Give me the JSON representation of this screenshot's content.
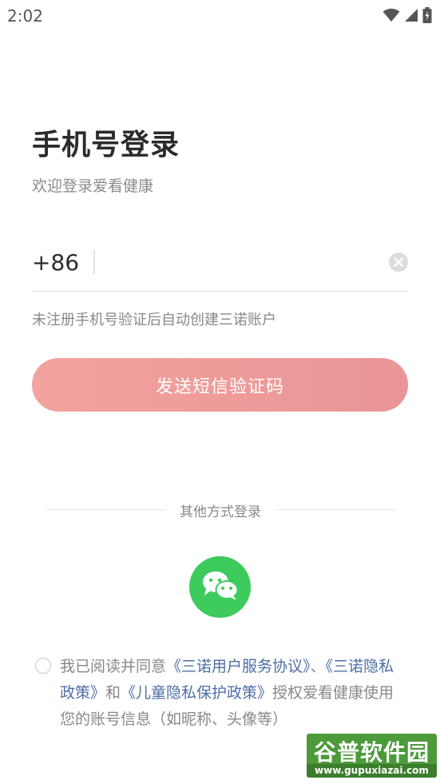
{
  "status_bar": {
    "time": "2:02",
    "icons": [
      "wifi-icon",
      "signal-icon",
      "battery-icon"
    ]
  },
  "header": {
    "title": "手机号登录",
    "subtitle": "欢迎登录爱看健康"
  },
  "phone": {
    "country_code": "+86",
    "value": "",
    "placeholder": ""
  },
  "hint": "未注册手机号验证后自动创建三诺账户",
  "send_button_label": "发送短信验证码",
  "other_login": {
    "label": "其他方式登录",
    "options": [
      "wechat-icon"
    ]
  },
  "agreement": {
    "prefix": "我已阅读并同意",
    "link_service": "《三诺用户服务协议》",
    "sep": "、",
    "link_privacy": "《三诺隐私政策》",
    "and": "和",
    "link_child": "《儿童隐私保护政策》",
    "suffix": "授权爱看健康使用您的账号信息（如昵称、头像等）"
  },
  "watermark": {
    "brand": "谷普软件园",
    "url": "www.gupuxiazai.com"
  },
  "colors": {
    "button_start": "#f3a39e",
    "button_end": "#e99597",
    "wechat_green": "#3ccb5c",
    "link_blue": "#4d6ea6"
  }
}
